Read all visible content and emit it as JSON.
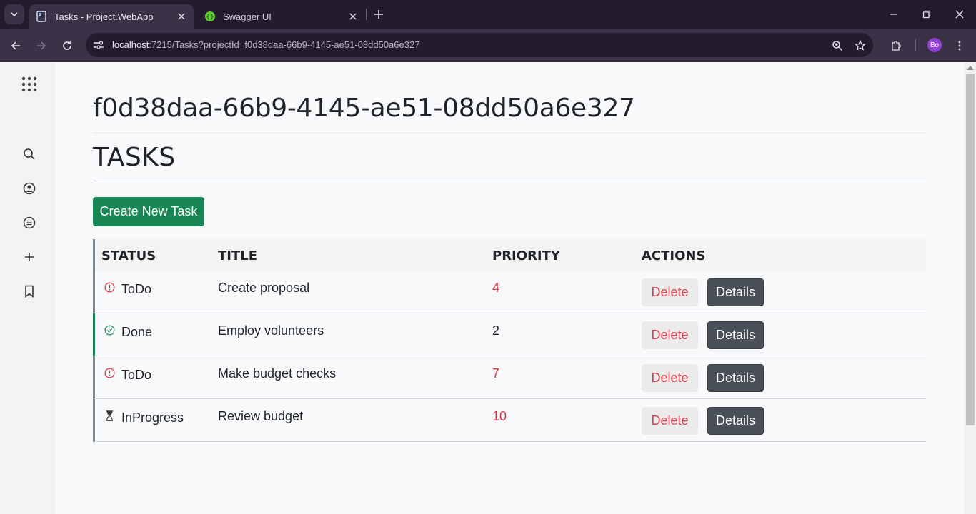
{
  "browser": {
    "tabs": [
      {
        "label": "Tasks - Project.WebApp",
        "active": true,
        "icon": "page-icon"
      },
      {
        "label": "Swagger UI",
        "active": false,
        "icon": "swagger-icon"
      }
    ],
    "url_host": "localhost",
    "url_rest": ":7215/Tasks?projectId=f0d38daa-66b9-4145-ae51-08dd50a6e327",
    "profile_initials": "Bo"
  },
  "sidebar": {
    "icons": [
      "apps-grid-icon",
      "search-icon",
      "account-icon",
      "list-icon",
      "plus-icon",
      "bookmark-icon"
    ]
  },
  "page": {
    "project_id": "f0d38daa-66b9-4145-ae51-08dd50a6e327",
    "heading": "TASKS",
    "create_button": "Create New Task"
  },
  "table": {
    "headers": [
      "STATUS",
      "TITLE",
      "PRIORITY",
      "ACTIONS"
    ],
    "rows": [
      {
        "status": "ToDo",
        "status_icon": "alert-circle-icon",
        "title": "Create proposal",
        "priority": "4",
        "priority_color": "#dc3545"
      },
      {
        "status": "Done",
        "status_icon": "check-circle-icon",
        "title": "Employ volunteers",
        "priority": "2",
        "priority_color": "#1f2328"
      },
      {
        "status": "ToDo",
        "status_icon": "alert-circle-icon",
        "title": "Make budget checks",
        "priority": "7",
        "priority_color": "#dc3545"
      },
      {
        "status": "InProgress",
        "status_icon": "hourglass-icon",
        "title": "Review budget",
        "priority": "10",
        "priority_color": "#dc3545"
      }
    ],
    "delete_label": "Delete",
    "details_label": "Details"
  },
  "colors": {
    "primary_green": "#198754",
    "danger_red": "#dc3545",
    "dark_button": "#495057"
  }
}
